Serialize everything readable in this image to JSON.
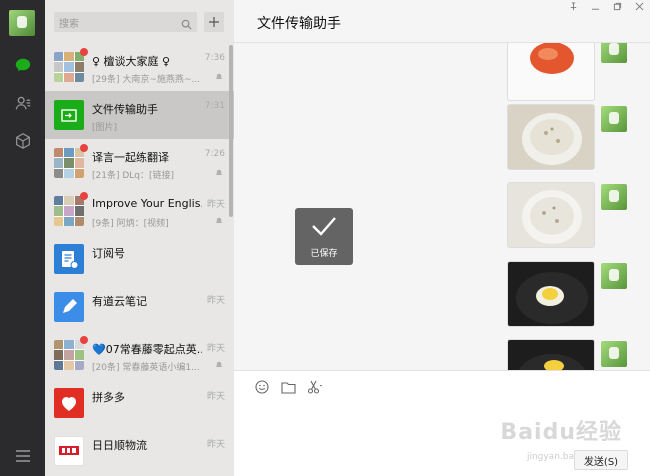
{
  "window": {
    "title": "文件传输助手"
  },
  "search": {
    "placeholder": "搜索"
  },
  "chats": [
    {
      "name": "♀ 檀谈大家庭 ♀",
      "preview": "[29条] 大南京~施燕燕~...",
      "time": "7:36",
      "muted": true,
      "unread_dot": true
    },
    {
      "name": "文件传输助手",
      "preview": "[图片]",
      "time": "7:31",
      "muted": false,
      "unread_dot": false,
      "active": true
    },
    {
      "name": "译言一起练翻译",
      "preview": "[21条] DLq：[链接]",
      "time": "7:26",
      "muted": true,
      "unread_dot": true
    },
    {
      "name": "Improve Your Englis...",
      "preview": "[9条] 阿炳：[视频]",
      "time": "昨天",
      "muted": true,
      "unread_dot": true
    },
    {
      "name": "订阅号",
      "preview": "",
      "time": "",
      "muted": false,
      "unread_dot": false
    },
    {
      "name": "有道云笔记",
      "preview": "",
      "time": "昨天",
      "muted": false,
      "unread_dot": false
    },
    {
      "name": "💙07常春藤零起点英...",
      "preview": "[20条] 常春藤英语小编1...",
      "time": "昨天",
      "muted": true,
      "unread_dot": true
    },
    {
      "name": "拼多多",
      "preview": "",
      "time": "昨天",
      "muted": false,
      "unread_dot": false
    },
    {
      "name": "日日顺物流",
      "preview": "",
      "time": "昨天",
      "muted": false,
      "unread_dot": false
    }
  ],
  "toast": {
    "label": "已保存"
  },
  "composer": {
    "send_label": "发送(S)"
  },
  "watermark": {
    "brand": "Baidu经验",
    "url": "jingyan.baidu.com"
  },
  "colors": {
    "accent": "#1aad19",
    "rail": "#2b2b2d",
    "list": "#e8e7e6",
    "unread": "#e64340"
  }
}
